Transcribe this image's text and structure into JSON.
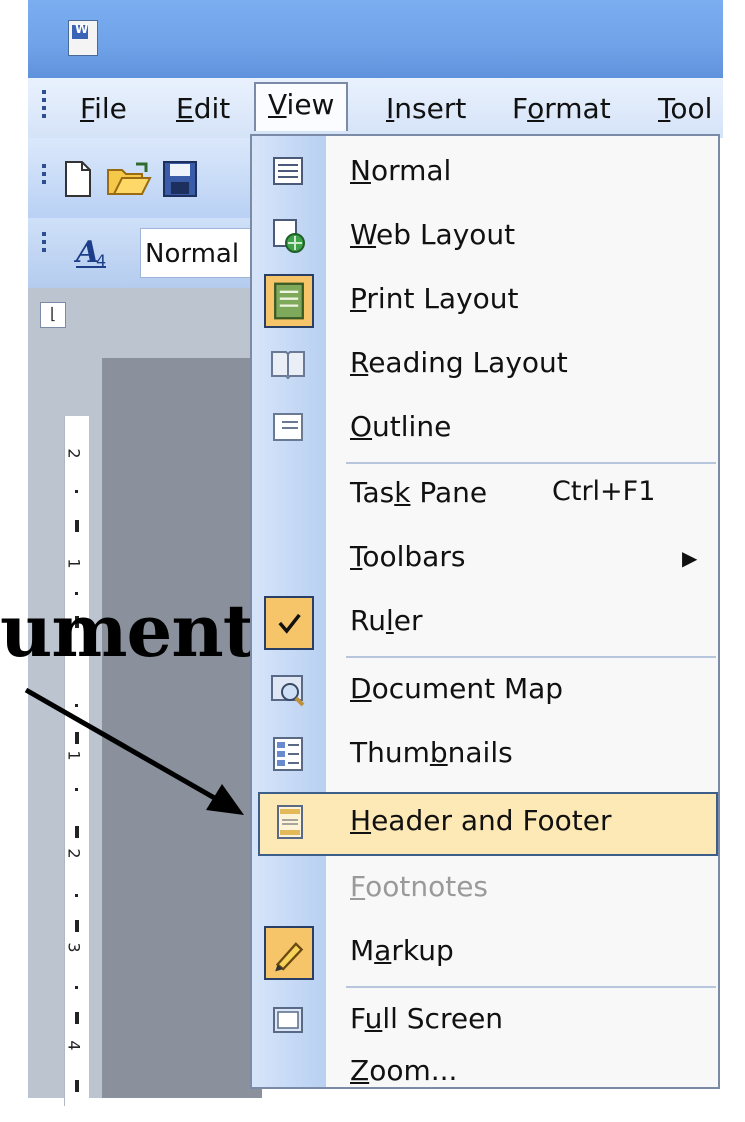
{
  "menubar": {
    "items": [
      {
        "label": "File",
        "underline": "F"
      },
      {
        "label": "Edit",
        "underline": "E"
      },
      {
        "label": "View",
        "underline": "V"
      },
      {
        "label": "Insert",
        "underline": "I"
      },
      {
        "label": "Format",
        "underline": "o"
      },
      {
        "label": "Tool",
        "underline": "T"
      }
    ]
  },
  "formatting": {
    "style_value": "Normal"
  },
  "document": {
    "partial_text": "ument"
  },
  "view_menu": {
    "items": [
      {
        "pre": "",
        "u": "N",
        "post": "ormal",
        "icon": "normal-view-icon"
      },
      {
        "pre": "",
        "u": "W",
        "post": "eb Layout",
        "icon": "web-layout-icon"
      },
      {
        "pre": "",
        "u": "P",
        "post": "rint Layout",
        "icon": "print-layout-icon"
      },
      {
        "pre": "",
        "u": "R",
        "post": "eading Layout",
        "icon": "reading-layout-icon"
      },
      {
        "pre": "",
        "u": "O",
        "post": "utline",
        "icon": "outline-icon"
      },
      {
        "pre": "Tas",
        "u": "k",
        "post": " Pane",
        "shortcut": "Ctrl+F1"
      },
      {
        "pre": "",
        "u": "T",
        "post": "oolbars"
      },
      {
        "pre": "Ru",
        "u": "l",
        "post": "er",
        "icon": "checkmark-icon"
      },
      {
        "pre": "",
        "u": "D",
        "post": "ocument Map",
        "icon": "document-map-icon"
      },
      {
        "pre": "Thum",
        "u": "b",
        "post": "nails",
        "icon": "thumbnails-icon"
      },
      {
        "pre": "",
        "u": "H",
        "post": "eader and Footer",
        "icon": "header-footer-icon"
      },
      {
        "pre": "",
        "u": "F",
        "post": "ootnotes"
      },
      {
        "pre": "M",
        "u": "a",
        "post": "rkup",
        "icon": "markup-icon"
      },
      {
        "pre": "F",
        "u": "u",
        "post": "ll Screen",
        "icon": "full-screen-icon"
      },
      {
        "pre": "",
        "u": "Z",
        "post": "oom...",
        "icon": ""
      }
    ],
    "highlighted": "Header and Footer",
    "disabled": "Footnotes"
  },
  "ruler": {
    "numbers": [
      "2",
      "1",
      "1",
      "2",
      "3",
      "4"
    ]
  },
  "colors": {
    "highlight": "#fde9b5",
    "gutter": "#c6daf5",
    "menubar": "#dde9fa"
  }
}
